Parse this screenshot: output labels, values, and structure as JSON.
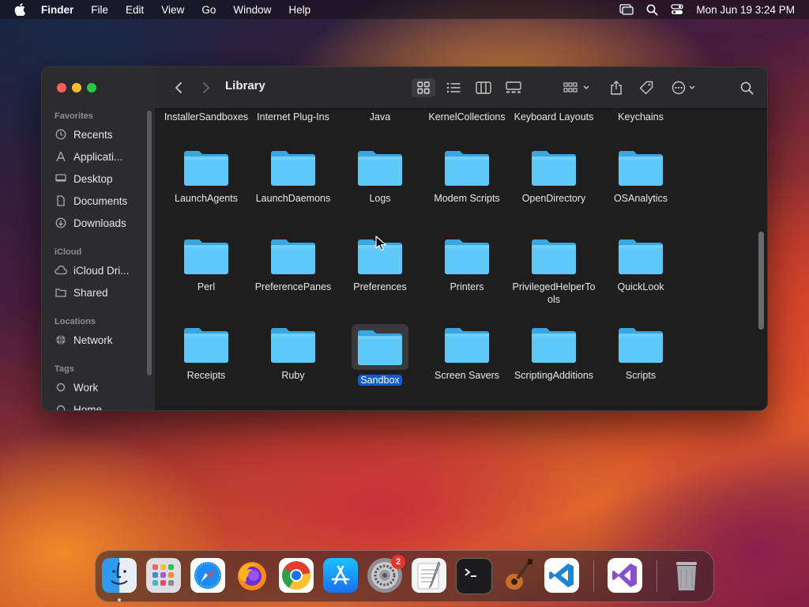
{
  "menubar": {
    "app": "Finder",
    "items": [
      "File",
      "Edit",
      "View",
      "Go",
      "Window",
      "Help"
    ],
    "clock": "Mon Jun 19  3:24 PM"
  },
  "window": {
    "title": "Library",
    "sidebar": {
      "favorites_header": "Favorites",
      "favorites": [
        {
          "label": "Recents",
          "icon": "clock-icon"
        },
        {
          "label": "Applicati...",
          "icon": "applications-icon"
        },
        {
          "label": "Desktop",
          "icon": "desktop-icon"
        },
        {
          "label": "Documents",
          "icon": "document-icon"
        },
        {
          "label": "Downloads",
          "icon": "download-icon"
        }
      ],
      "icloud_header": "iCloud",
      "icloud": [
        {
          "label": "iCloud Dri...",
          "icon": "cloud-icon"
        },
        {
          "label": "Shared",
          "icon": "shared-folder-icon"
        }
      ],
      "locations_header": "Locations",
      "locations": [
        {
          "label": "Network",
          "icon": "globe-icon"
        }
      ],
      "tags_header": "Tags",
      "tags": [
        {
          "label": "Work",
          "icon": "tag-dot-icon"
        },
        {
          "label": "Home",
          "icon": "tag-dot-icon"
        }
      ]
    },
    "folders_top_row": [
      "InstallerSandboxes",
      "Internet Plug-Ins",
      "Java",
      "KernelCollections",
      "Keyboard Layouts",
      "Keychains"
    ],
    "folders": [
      [
        "LaunchAgents",
        "LaunchDaemons",
        "Logs",
        "Modem Scripts",
        "OpenDirectory",
        "OSAnalytics"
      ],
      [
        "Perl",
        "PreferencePanes",
        "Preferences",
        "Printers",
        "PrivilegedHelperTools",
        "QuickLook"
      ],
      [
        "Receipts",
        "Ruby",
        "Sandbox",
        "Screen Savers",
        "ScriptingAdditions",
        "Scripts"
      ]
    ],
    "selected_folder": "Sandbox"
  },
  "dock": {
    "apps": [
      "Finder",
      "Launchpad",
      "Safari",
      "Firefox",
      "Chrome",
      "App Store",
      "System Settings",
      "TextEdit",
      "Terminal",
      "GarageBand",
      "Visual Studio Code",
      "Visual Studio",
      "Trash"
    ],
    "settings_badge": "2"
  },
  "colors": {
    "folder": "#5ec8f8",
    "selection": "#0b5ad9"
  }
}
